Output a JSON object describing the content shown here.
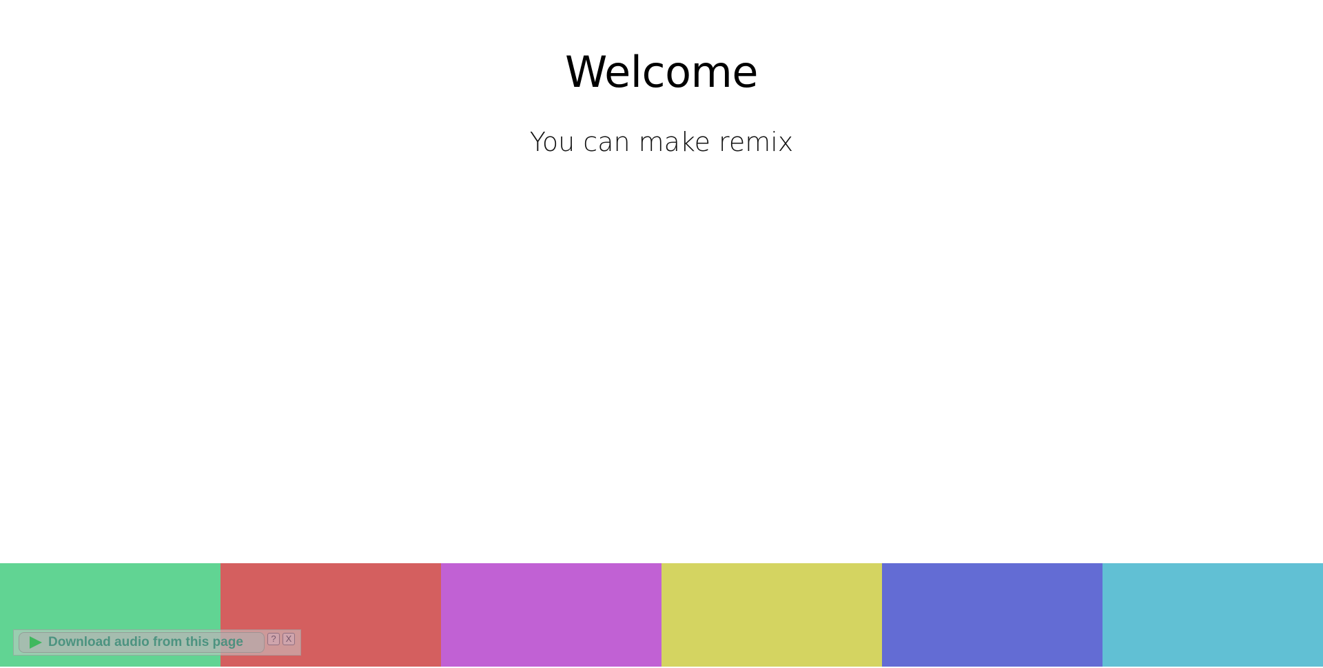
{
  "hero": {
    "title": "Welcome",
    "subtitle": "You can make remix"
  },
  "color_blocks": [
    {
      "name": "green",
      "color": "#61d493"
    },
    {
      "name": "red",
      "color": "#d45f5f"
    },
    {
      "name": "purple",
      "color": "#c161d4"
    },
    {
      "name": "yellow",
      "color": "#d4d461"
    },
    {
      "name": "blue",
      "color": "#636cd4"
    },
    {
      "name": "cyan",
      "color": "#61c0d4"
    }
  ],
  "download_widget": {
    "label": "Download audio from this page",
    "help_label": "?",
    "close_label": "X"
  }
}
